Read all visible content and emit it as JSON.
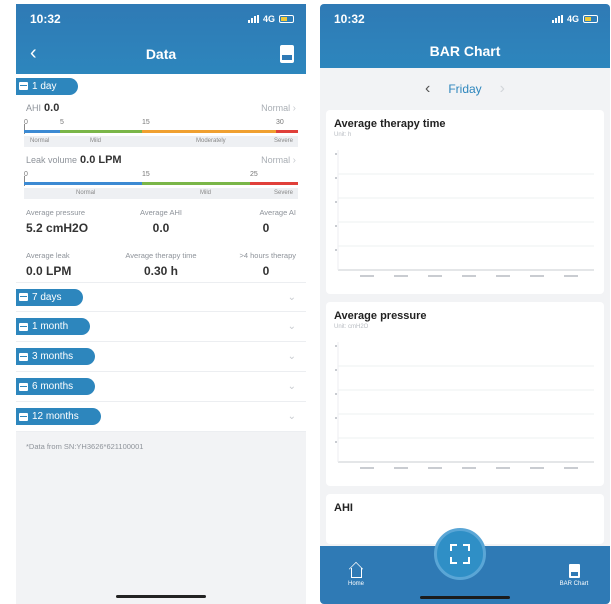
{
  "left": {
    "status": {
      "time": "10:32",
      "network": "4G"
    },
    "title": "Data",
    "day_section": {
      "label": "1 day",
      "ahi": {
        "label": "AHI",
        "value": "0.0",
        "status": "Normal",
        "ticks": [
          "5",
          "15",
          "30"
        ],
        "zones": [
          "Normal",
          "Mild",
          "Moderately",
          "Severe"
        ]
      },
      "leak": {
        "label": "Leak volume",
        "value": "0.0 LPM",
        "status": "Normal",
        "ticks": [
          "15",
          "25"
        ],
        "zones": [
          "Normal",
          "Mild",
          "Severe"
        ]
      },
      "stats": [
        {
          "label": "Average pressure",
          "value": "5.2 cmH2O"
        },
        {
          "label": "Average AHI",
          "value": "0.0"
        },
        {
          "label": "Average AI",
          "value": "0"
        },
        {
          "label": "Average leak",
          "value": "0.0 LPM"
        },
        {
          "label": "Average therapy time",
          "value": "0.30 h"
        },
        {
          "label": ">4 hours therapy",
          "value": "0"
        }
      ]
    },
    "periods": [
      "7 days",
      "1 month",
      "3 months",
      "6 months",
      "12 months"
    ],
    "footnote": "*Data from SN:YH3626*621100001"
  },
  "right": {
    "status": {
      "time": "10:32",
      "network": "4G"
    },
    "title": "BAR Chart",
    "day": "Friday",
    "charts": [
      {
        "title": "Average therapy time",
        "unit": "Unit: h"
      },
      {
        "title": "Average pressure",
        "unit": "Unit: cmH2O"
      },
      {
        "title": "AHI",
        "unit": ""
      }
    ],
    "tabs": {
      "home": "Home",
      "bar_chart": "BAR Chart"
    }
  },
  "colors": {
    "primary": "#2d86bd",
    "normal": "#3c8ad3",
    "mild": "#7ab648",
    "moderate": "#f0a030",
    "severe": "#e0403a"
  }
}
